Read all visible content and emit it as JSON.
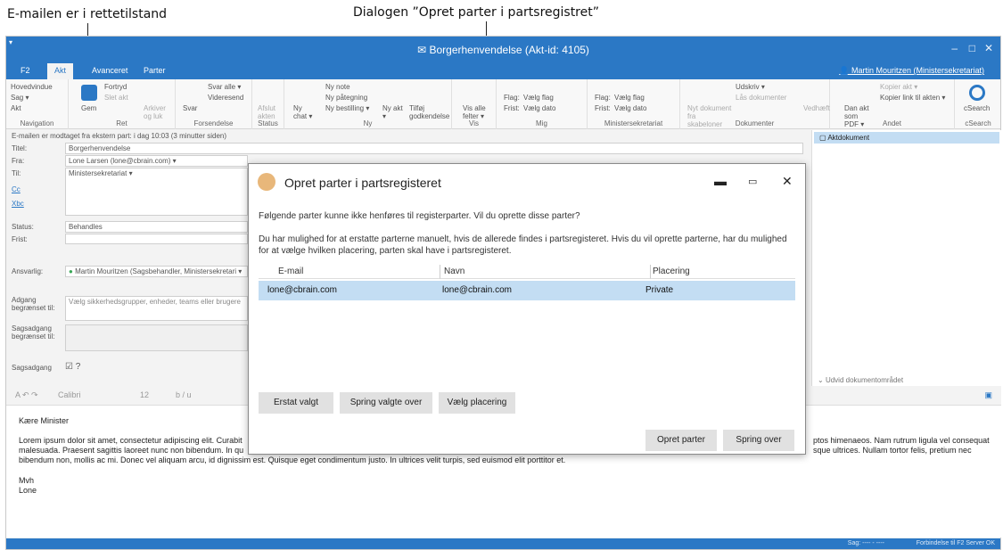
{
  "callouts": {
    "left": "E-mailen er i rettetilstand",
    "right": "Dialogen ”Opret parter i partsregistret”"
  },
  "window": {
    "title": "Borgerhenvendelse (Akt-id: 4105)",
    "min": "–",
    "max": "□",
    "close": "✕"
  },
  "tabs": [
    "F2",
    "Akt",
    "Avanceret",
    "Parter"
  ],
  "user": "Martin Mouritzen (Ministersekretariat)",
  "ribbon": {
    "navigation": {
      "label": "Navigation",
      "items": [
        "Hovedvindue",
        "Sag ▾",
        "Akt"
      ]
    },
    "ret": {
      "label": "Ret",
      "gem": "Gem",
      "fortryd": "Fortryd",
      "slet": "Slet akt",
      "arkiver": "Arkiver og luk"
    },
    "forsendelse": {
      "label": "Forsendelse",
      "svar": "Svar",
      "svar_alle": "Svar alle ▾",
      "videresend": "Videresend"
    },
    "status": {
      "label": "Status",
      "afslut": "Afslut akten"
    },
    "ny": {
      "label": "Ny",
      "ny_chat": "Ny chat ▾",
      "ny_note": "Ny note",
      "ny_paategning": "Ny påtegning",
      "ny_bestilling": "Ny bestilling ▾",
      "ny_akt": "Ny akt ▾",
      "tilfoj": "Tilføj godkendelse"
    },
    "vis": {
      "label": "Vis",
      "vis_alle": "Vis alle felter ▾"
    },
    "mig": {
      "label": "Mig",
      "flag": "Flag:",
      "flag_val": "Vælg flag",
      "frist": "Frist:",
      "frist_val": "Vælg dato"
    },
    "minister": {
      "label": "Ministersekretariat",
      "flag": "Flag:",
      "flag_val": "Vælg flag",
      "frist": "Frist:",
      "frist_val": "Vælg dato"
    },
    "dokumenter": {
      "label": "Dokumenter",
      "nyt": "Nyt dokument fra skabeloner",
      "udskriv": "Udskriv ▾",
      "laas": "Lås dokumenter",
      "vedhaeft": "Vedhæft"
    },
    "andet": {
      "label": "Andet",
      "dan": "Dan akt som PDF ▾",
      "kopier_akt": "Kopier akt ▾",
      "kopier_link": "Kopier link til akten ▾"
    },
    "csearch": {
      "label": "cSearch",
      "btn": "cSearch"
    }
  },
  "form": {
    "received": "E-mailen er modtaget fra ekstern part:   i dag 10:03 (3 minutter siden)",
    "titel_label": "Titel:",
    "titel": "Borgerhenvendelse",
    "fra_label": "Fra:",
    "fra": "Lone Larsen (lone@cbrain.com) ▾",
    "til_label": "Til:",
    "til": "Ministersekretariat ▾",
    "cc": "Cc",
    "bcc": "Xbc",
    "status_label": "Status:",
    "status": "Behandles",
    "frist_label": "Frist:",
    "ansvarlig_label": "Ansvarlig:",
    "ansvarlig": "Martin Mouritzen (Sagsbehandler, Ministersekretari ▾",
    "adgang_label": "Adgang begrænset til:",
    "adgang_ph": "Vælg sikkerhedsgrupper, enheder, teams eller brugere",
    "sagsadgang_label": "Sagsadgang begrænset til:",
    "sagsadgang2_label": "Sagsadgang"
  },
  "right": {
    "aktdokument": "Aktdokument",
    "udvid": "Udvid dokumentområdet"
  },
  "editor": {
    "font": "Calibri",
    "size": "12",
    "greeting": "Kære Minister",
    "body_left_1": "Lorem ipsum dolor sit amet, consectetur adipiscing elit. Curabit",
    "body_left_2": "malesuada. Praesent sagittis laoreet nunc non bibendum. In qu",
    "body_full_3": "bibendum non, mollis ac mi. Donec vel aliquam arcu, id dignissim est. Quisque eget condimentum justo. In ultrices velit turpis, sed euismod elit porttitor et.",
    "body_right_1": "ptos himenaeos. Nam rutrum ligula vel consequat",
    "body_right_2": "sque ultrices. Nullam tortor felis, pretium nec",
    "closing": "Mvh",
    "name": "Lone"
  },
  "statusbar": {
    "sag": "Sag: ---- - ----",
    "conn": "Forbindelse til F2 Server OK"
  },
  "dialog": {
    "title": "Opret parter i partsregisteret",
    "line1": "Følgende parter kunne ikke henføres til registerparter. Vil du oprette disse parter?",
    "line2": "Du har mulighed for at erstatte parterne manuelt, hvis de allerede findes i partsregisteret. Hvis du vil oprette parterne, har du mulighed",
    "line3": "for at vælge hvilken placering, parten skal have i partsregisteret.",
    "columns": [
      "E-mail",
      "Navn",
      "Placering"
    ],
    "rows": [
      {
        "email": "lone@cbrain.com",
        "navn": "lone@cbrain.com",
        "placering": "Private"
      }
    ],
    "btn_erstat": "Erstat valgt",
    "btn_spring_valgte": "Spring valgte over",
    "btn_vaelg": "Vælg placering",
    "btn_opret": "Opret parter",
    "btn_spring": "Spring over"
  },
  "colors": {
    "accent": "#2b78c5",
    "selection": "#c3ddf3"
  }
}
